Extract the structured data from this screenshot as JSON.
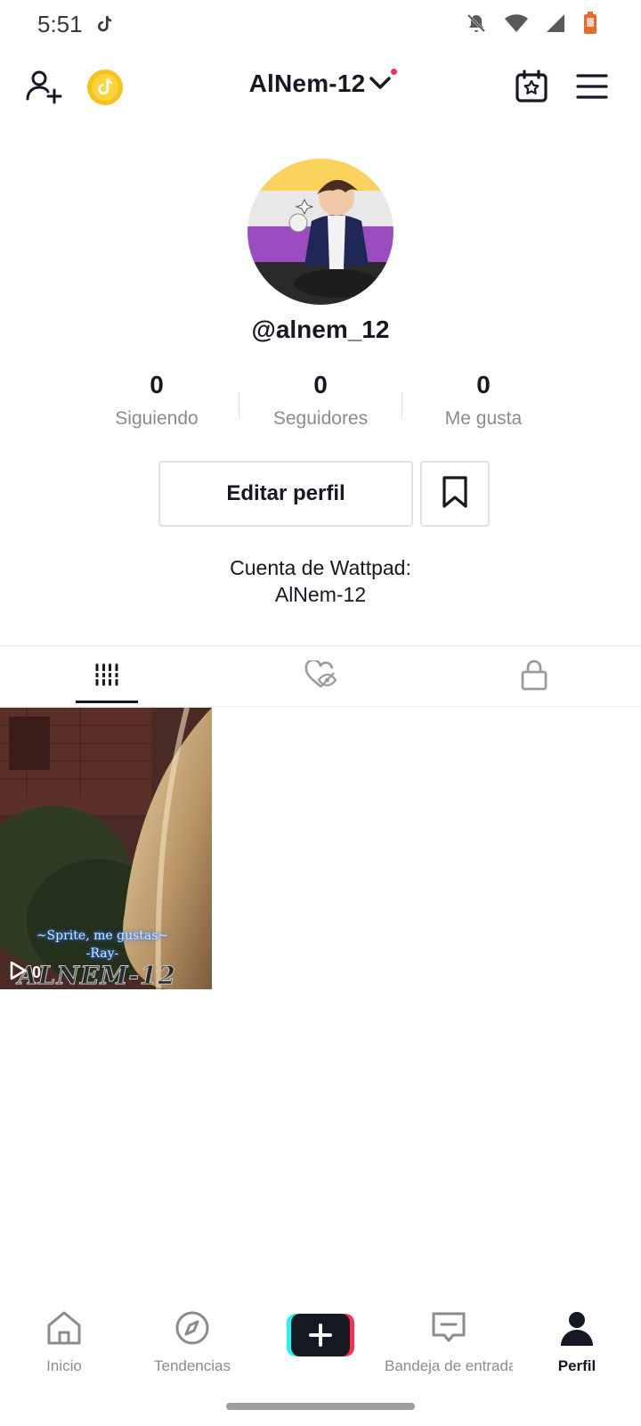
{
  "status_bar": {
    "time": "5:51",
    "icons": [
      "tiktok-icon",
      "bell-off-icon",
      "wifi-icon",
      "signal-icon",
      "battery-icon"
    ],
    "battery_color": "#e86a2a"
  },
  "header": {
    "username": "AlNem-12",
    "has_notification_dot": true,
    "icons": [
      "add-user-icon",
      "coin-icon",
      "chevron-down-icon",
      "calendar-star-icon",
      "menu-icon"
    ]
  },
  "profile": {
    "handle": "@alnem_12",
    "stats": [
      {
        "value": "0",
        "label": "Siguiendo"
      },
      {
        "value": "0",
        "label": "Seguidores"
      },
      {
        "value": "0",
        "label": "Me gusta"
      }
    ],
    "edit_button": "Editar perfil",
    "bio_line1": "Cuenta de Wattpad:",
    "bio_line2": "AlNem-12"
  },
  "tabs": [
    {
      "name": "videos",
      "icon": "grid-icon",
      "active": true
    },
    {
      "name": "liked",
      "icon": "hidden-heart-icon",
      "active": false
    },
    {
      "name": "private",
      "icon": "lock-icon",
      "active": false
    }
  ],
  "videos": [
    {
      "caption_line1": "~Sprite, me gustas~",
      "caption_line2": "-Ray-",
      "watermark": "ALNEM-12",
      "views": "0"
    }
  ],
  "bottom_nav": [
    {
      "label": "Inicio",
      "icon": "home-icon",
      "active": false
    },
    {
      "label": "Tendencias",
      "icon": "compass-icon",
      "active": false
    },
    {
      "label": "",
      "icon": "plus-icon",
      "active": false
    },
    {
      "label": "Bandeja de entrada",
      "icon": "inbox-icon",
      "active": false
    },
    {
      "label": "Perfil",
      "icon": "profile-icon",
      "active": true
    }
  ],
  "colors": {
    "accent_red": "#fe2c55",
    "accent_cyan": "#25f4ee",
    "text_primary": "#161823",
    "text_secondary": "#8a8b91"
  }
}
